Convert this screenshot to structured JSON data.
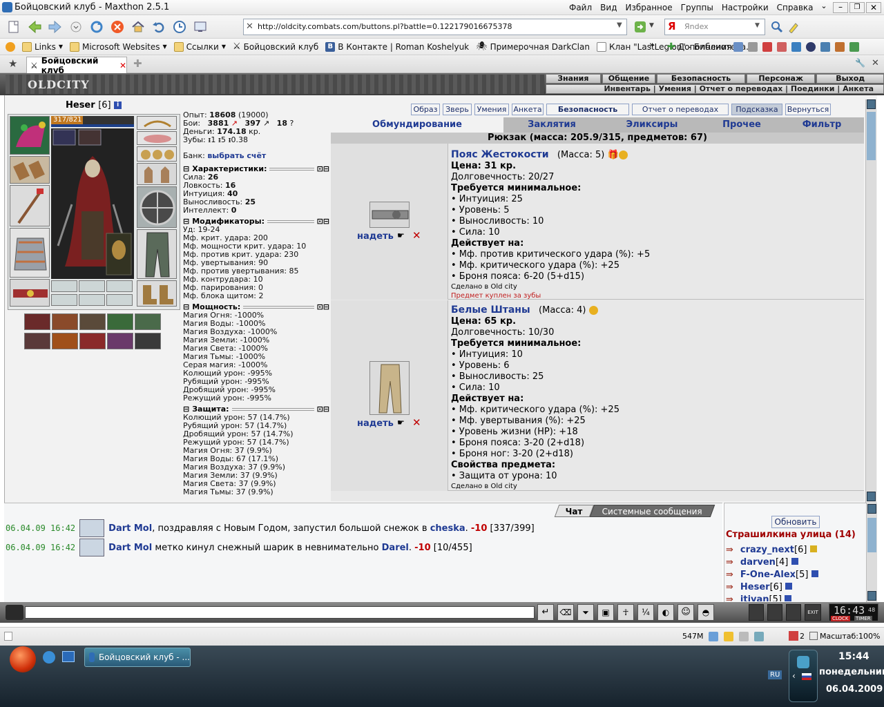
{
  "window": {
    "title": "Бойцовский клуб - Maxthon 2.5.1",
    "menu": [
      "Файл",
      "Вид",
      "Избранное",
      "Группы",
      "Настройки",
      "Справка"
    ]
  },
  "toolbar": {
    "url": "http://oldcity.combats.com/buttons.pl?battle=0.122179016675378",
    "search_placeholder": "Яndex"
  },
  "favorites": {
    "items": [
      "Links",
      "Microsoft Websites",
      "Ссылки",
      "Бойцовский клуб",
      "В Контакте | Roman Koshelyuk",
      "Примерочная DarkClan",
      "Клан \"LastLegion\" - Библиотека..."
    ],
    "addons_label": "Дополнения"
  },
  "tab": {
    "label": "Бойцовский клуб"
  },
  "game": {
    "logo": "OLDCITY",
    "top_menu": [
      "Знания",
      "Общение",
      "Безопасность",
      "Персонаж",
      "Выход"
    ],
    "sub_menu": "Инвентарь | Умения | Отчет о переводах | Поединки | Анкета"
  },
  "character": {
    "name": "Heser",
    "level": "[6]",
    "hp": "317/821",
    "exp_label": "Опыт:",
    "exp_value": "18608",
    "exp_next": "(19000)",
    "battles_label": "Бои:",
    "battles_wins": "3881",
    "battles_losses": "397",
    "battles_draws": "18",
    "money_label": "Деньги:",
    "money_value": "174.18",
    "money_unit": "кр.",
    "teeth_label": "Зубы:",
    "teeth_a": "1",
    "teeth_b": "5",
    "teeth_c": "0.38",
    "bank_label": "Банк:",
    "bank_link": "выбрать счёт",
    "sections": {
      "chars": "Характеристики:",
      "mods": "Модификаторы:",
      "powers": "Мощность:",
      "defense": "Защита:"
    },
    "stats": [
      {
        "k": "Сила:",
        "v": "26"
      },
      {
        "k": "Ловкость:",
        "v": "16"
      },
      {
        "k": "Интуиция:",
        "v": "40"
      },
      {
        "k": "Выносливость:",
        "v": "25"
      },
      {
        "k": "Интеллект:",
        "v": "0"
      }
    ],
    "modifiers": [
      "Уд: 19-24",
      "Мф. крит. удара: 200",
      "Мф. мощности крит. удара: 10",
      "Мф. против крит. удара: 230",
      "Мф. увертывания: 90",
      "Мф. против увертывания: 85",
      "Мф. контрудара: 10",
      "Мф. парирования: 0",
      "Мф. блока щитом: 2"
    ],
    "powers": [
      "Магия Огня: -1000%",
      "Магия Воды: -1000%",
      "Магия Воздуха: -1000%",
      "Магия Земли: -1000%",
      "Магия Света: -1000%",
      "Магия Тьмы: -1000%",
      "Серая магия: -1000%",
      "Колющий урон: -995%",
      "Рубящий урон: -995%",
      "Дробящий урон: -995%",
      "Режущий урон: -995%"
    ],
    "defense": [
      "Колющий урон: 57 (14.7%)",
      "Рубящий урон: 57 (14.7%)",
      "Дробящий урон: 57 (14.7%)",
      "Режущий урон: 57 (14.7%)",
      "Магия Огня: 37 (9.9%)",
      "Магия Воды: 67 (17.1%)",
      "Магия Воздуха: 37 (9.9%)",
      "Магия Земли: 37 (9.9%)",
      "Магия Света: 37 (9.9%)",
      "Магия Тьмы: 37 (9.9%)"
    ]
  },
  "nav": {
    "buttons": [
      "Образ",
      "Зверь",
      "Умения",
      "Анкета",
      "Безопасность",
      "Отчет о переводах",
      "Подсказка",
      "Вернуться"
    ],
    "tabs": [
      "Обмундирование",
      "Заклятия",
      "Эликсиры",
      "Прочее",
      "Фильтр"
    ],
    "backpack": "Рюкзак (масса: 205.9/315, предметов: 67)"
  },
  "items": [
    {
      "name": "Пояс Жестокости",
      "mass": "(Масса: 5)",
      "price": "Цена: 31 кр.",
      "durability": "Долговечность: 20/27",
      "req_title": "Требуется минимальное:",
      "reqs": [
        "• Интуиция: 25",
        "• Уровень: 5",
        "• Выносливость: 10",
        "• Сила: 10"
      ],
      "eff_title": "Действует на:",
      "effects": [
        "• Мф. против критического удара (%): +5",
        "• Мф. критического удара (%): +25",
        "• Броня пояса: 6-20 (5+d15)"
      ],
      "made": "Сделано в Old city",
      "note": "Предмет куплен за зубы",
      "wear": "надеть"
    },
    {
      "name": "Белые Штаны",
      "mass": "(Масса: 4)",
      "price": "Цена: 65 кр.",
      "durability": "Долговечность: 10/30",
      "req_title": "Требуется минимальное:",
      "reqs": [
        "• Интуиция: 10",
        "• Уровень: 6",
        "• Выносливость: 25",
        "• Сила: 10"
      ],
      "eff_title": "Действует на:",
      "effects": [
        "• Мф. критического удара (%): +25",
        "• Мф. увертывания (%): +25",
        "• Уровень жизни (HP): +18",
        "• Броня пояса: 3-20 (2+d18)",
        "• Броня ног: 3-20 (2+d18)"
      ],
      "props_title": "Свойства предмета:",
      "props": [
        "• Защита от урона: 10"
      ],
      "made": "Сделано в Old city",
      "wear": "надеть"
    }
  ],
  "chat": {
    "tabs": [
      "Чат",
      "Системные сообщения"
    ],
    "messages": [
      {
        "time": "06.04.09 16:42",
        "who": "Dart Mol",
        "text": ", поздравляя с Новым Годом, запустил большой снежок в ",
        "target": "cheska",
        "dmg": "-10",
        "hp": "[337/399]"
      },
      {
        "time": "06.04.09 16:42",
        "who": "Dart Mol",
        "text": " метко кинул снежный шарик в невнимательно ",
        "target": "Darel",
        "dmg": "-10",
        "hp": "[10/455]"
      }
    ]
  },
  "people": {
    "refresh": "Обновить",
    "location": "Страшилкина улица (14)",
    "list": [
      {
        "name": "crazy_next",
        "lvl": "[6]"
      },
      {
        "name": "darven",
        "lvl": "[4]"
      },
      {
        "name": "F-One-Alex",
        "lvl": "[5]"
      },
      {
        "name": "Heser",
        "lvl": "[6]"
      },
      {
        "name": "itiyan",
        "lvl": "[5]"
      }
    ]
  },
  "clock": {
    "time": "16:43",
    "sec": "48",
    "labels": [
      "CLOCK",
      "TIMER"
    ],
    "exit": "EXIT"
  },
  "status": {
    "mem": "547M",
    "tabs": "2",
    "zoom": "Масштаб:100%"
  },
  "taskbar": {
    "window": "Бойцовский клуб - ...",
    "lang": "RU",
    "time": "15:44",
    "day": "понедельник",
    "date": "06.04.2009"
  }
}
